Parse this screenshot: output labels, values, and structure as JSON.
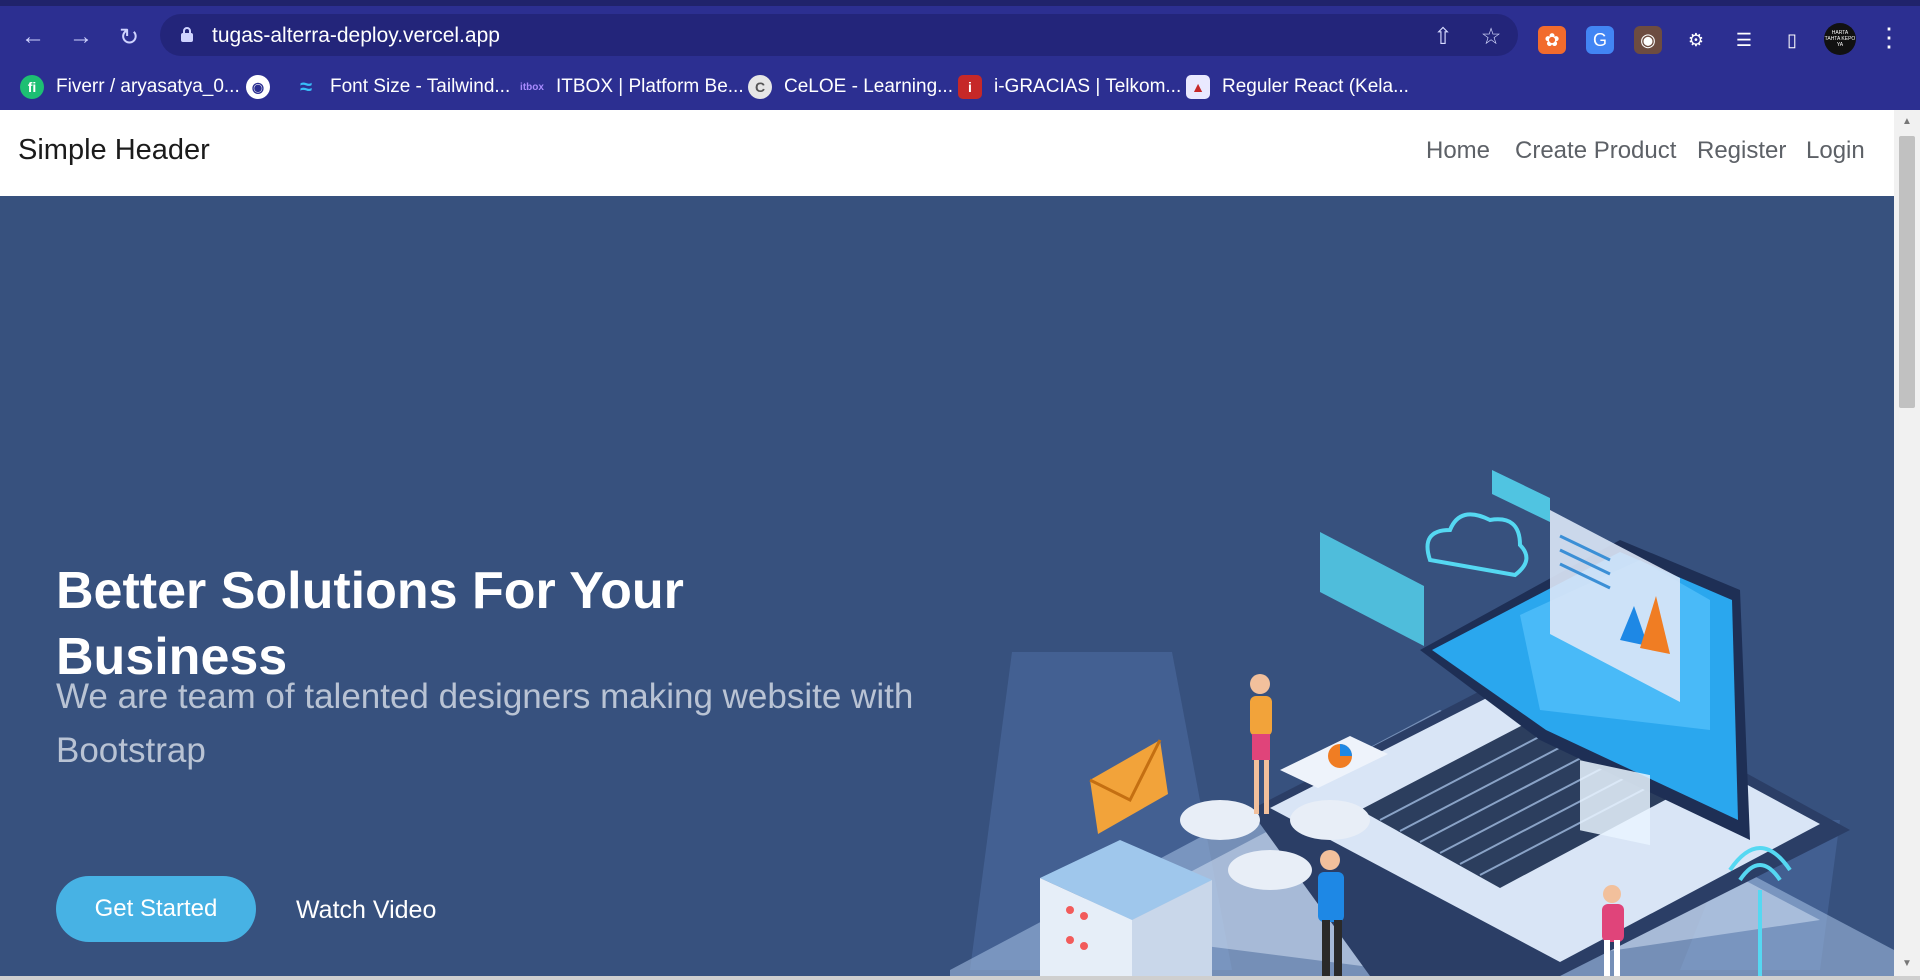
{
  "browser": {
    "url": "tugas-alterra-deploy.vercel.app",
    "bookmarks": [
      {
        "label": "Fiverr / aryasatya_0...",
        "icon": "fiverr-icon",
        "color": "#1dbf73",
        "glyph": "fi"
      },
      {
        "label": "",
        "icon": "globe-icon",
        "color": "#2c2f91",
        "glyph": ""
      },
      {
        "label": "Font Size - Tailwind...",
        "icon": "tailwind-icon",
        "color": "#38bdf8",
        "glyph": "~"
      },
      {
        "label": "ITBOX | Platform Be...",
        "icon": "itbox-icon",
        "color": "#6b5bd6",
        "glyph": "it"
      },
      {
        "label": "CeLOE - Learning...",
        "icon": "celoe-icon",
        "color": "#555555",
        "glyph": "C"
      },
      {
        "label": "i-GRACIAS | Telkom...",
        "icon": "igracias-icon",
        "color": "#c62828",
        "glyph": "i"
      },
      {
        "label": "Reguler React (Kela...",
        "icon": "alterra-icon",
        "color": "#e9e9ff",
        "glyph": "A"
      }
    ],
    "avatar_text": "HARTA TAHTA KEPO YA"
  },
  "site": {
    "brand": "Simple Header",
    "nav": [
      "Home",
      "Create Product",
      "Register",
      "Login"
    ]
  },
  "hero": {
    "title": "Better Solutions For Your Business",
    "subtitle": "We are team of talented designers making website with Bootstrap",
    "primary_button": "Get Started",
    "secondary_button": "Watch Video"
  },
  "colors": {
    "hero_bg": "#37517e",
    "accent": "#47b2e4",
    "browser_chrome": "#2c2f91"
  }
}
